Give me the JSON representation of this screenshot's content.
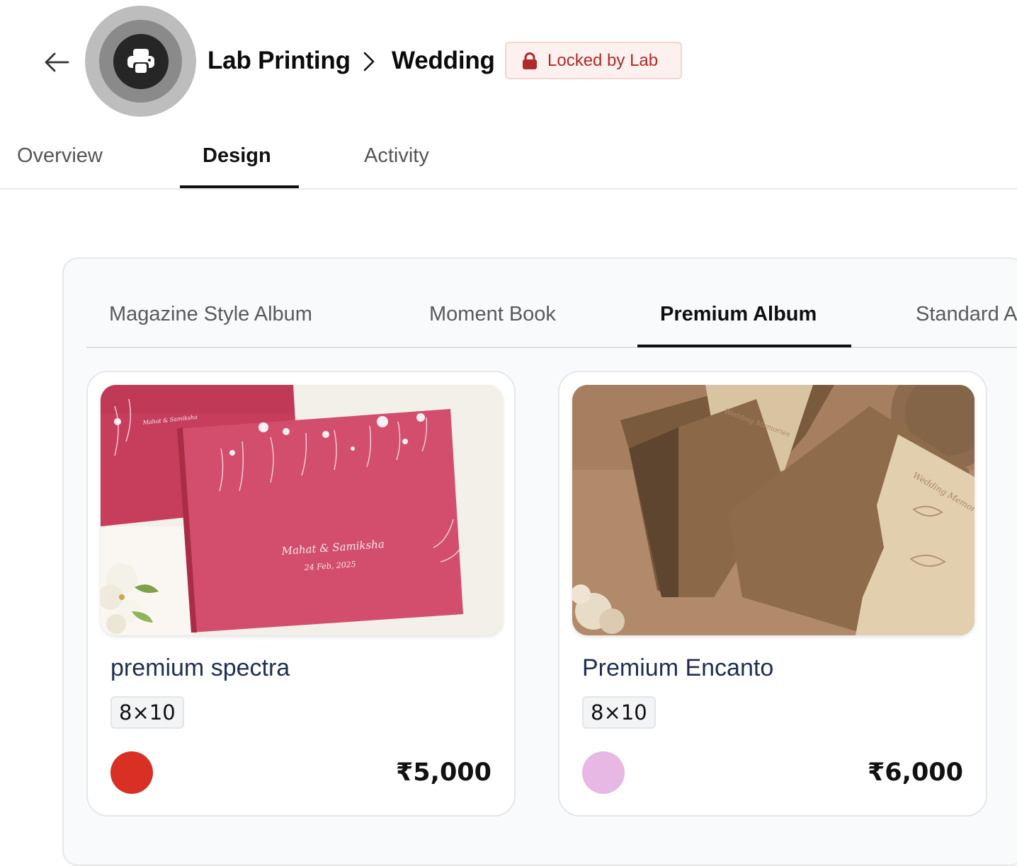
{
  "header": {
    "back_icon": "arrow-left-icon",
    "avatar_icon": "printer-icon",
    "breadcrumb": [
      "Lab Printing",
      "Wedding"
    ],
    "separator_icon": "chevron-right-icon",
    "lock_badge": {
      "label": "Locked by Lab",
      "icon": "lock-icon",
      "color": "#b02a27"
    }
  },
  "tabs": [
    {
      "label": "Overview",
      "active": false
    },
    {
      "label": "Design",
      "active": true
    },
    {
      "label": "Activity",
      "active": false
    }
  ],
  "album_types": [
    {
      "label": "Magazine Style Album",
      "active": false
    },
    {
      "label": "Moment Book",
      "active": false
    },
    {
      "label": "Premium Album",
      "active": true
    },
    {
      "label": "Standard Album",
      "active": false
    }
  ],
  "products": [
    {
      "name": "premium spectra",
      "size": "8×10",
      "color": "#d93025",
      "price": "₹5,000",
      "image": "red-album-cover-image",
      "cover_text": [
        "Mahat & Samiksha",
        "24 Feb, 2025"
      ]
    },
    {
      "name": "Premium Encanto",
      "size": "8×10",
      "color": "#e6b8e3",
      "price": "₹6,000",
      "image": "brown-wood-album-image",
      "cover_text": [
        "Wedding Memories"
      ]
    }
  ]
}
